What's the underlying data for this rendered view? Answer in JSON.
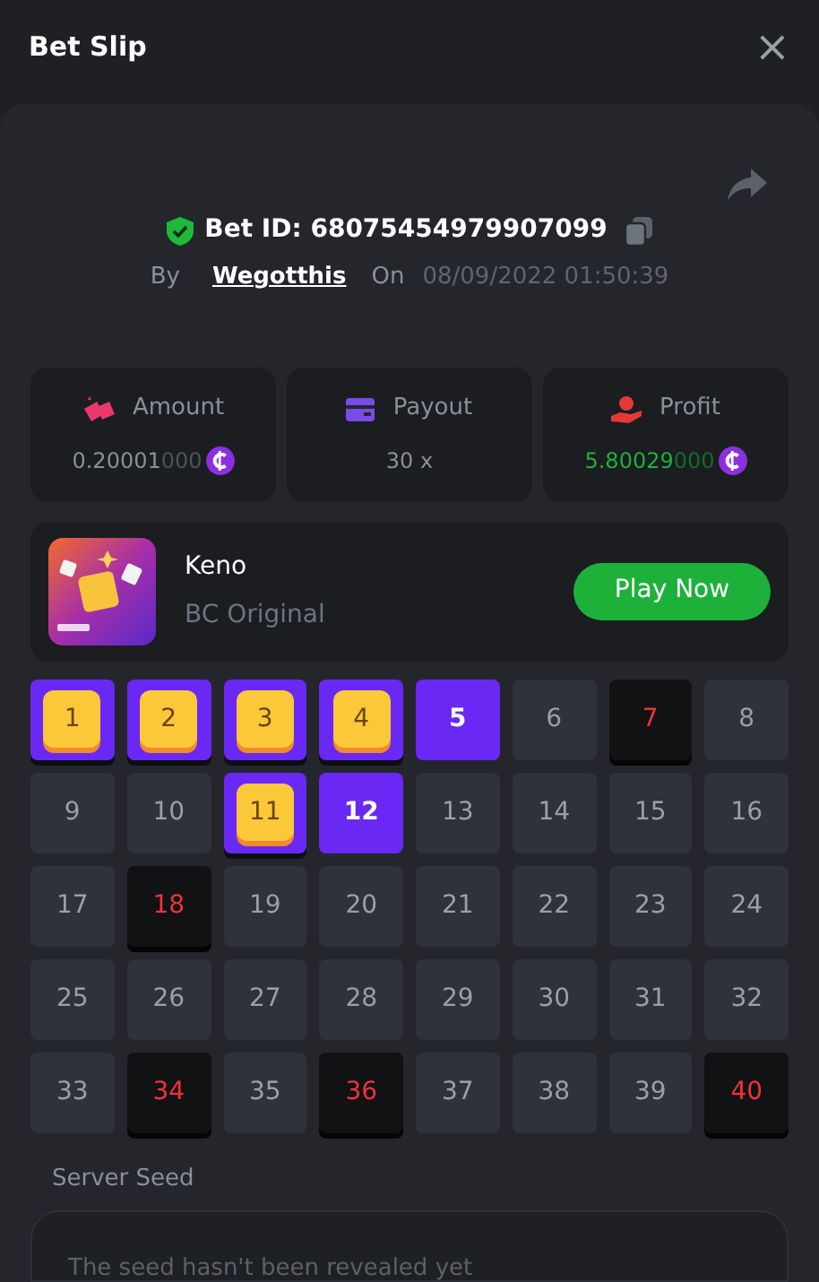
{
  "header": {
    "title": "Bet Slip",
    "close": "×"
  },
  "bet": {
    "id_label": "Bet ID: 68075454979907099",
    "verified": true,
    "by_label": "By",
    "user": "Wegotthis",
    "on_label": "On",
    "date": "08/09/2022 01:50:39"
  },
  "stats": [
    {
      "kind": "amount",
      "label": "Amount",
      "value": "0.20001",
      "trailing": "000",
      "coin": true
    },
    {
      "kind": "payout",
      "label": "Payout",
      "value": "30 x",
      "coin": false
    },
    {
      "kind": "profit",
      "label": "Profit",
      "value": "5.80029",
      "trailing": "000",
      "coin": true
    }
  ],
  "game": {
    "name": "Keno",
    "subtitle": "BC Original",
    "button": "Play Now"
  },
  "tiles": [
    {
      "number": "1",
      "picked": true,
      "drawn": true
    },
    {
      "number": "2",
      "picked": true,
      "drawn": true
    },
    {
      "number": "3",
      "picked": true,
      "drawn": true
    },
    {
      "number": "4",
      "picked": true,
      "drawn": true
    },
    {
      "number": "5",
      "picked": true,
      "drawn": false
    },
    {
      "number": "6",
      "picked": false,
      "drawn": false
    },
    {
      "number": "7",
      "picked": false,
      "drawn": true
    },
    {
      "number": "8",
      "picked": false,
      "drawn": false
    },
    {
      "number": "9",
      "picked": false,
      "drawn": false
    },
    {
      "number": "10",
      "picked": false,
      "drawn": false
    },
    {
      "number": "11",
      "picked": true,
      "drawn": true
    },
    {
      "number": "12",
      "picked": true,
      "drawn": false
    },
    {
      "number": "13",
      "picked": false,
      "drawn": false
    },
    {
      "number": "14",
      "picked": false,
      "drawn": false
    },
    {
      "number": "15",
      "picked": false,
      "drawn": false
    },
    {
      "number": "16",
      "picked": false,
      "drawn": false
    },
    {
      "number": "17",
      "picked": false,
      "drawn": false
    },
    {
      "number": "18",
      "picked": false,
      "drawn": true
    },
    {
      "number": "19",
      "picked": false,
      "drawn": false
    },
    {
      "number": "20",
      "picked": false,
      "drawn": false
    },
    {
      "number": "21",
      "picked": false,
      "drawn": false
    },
    {
      "number": "22",
      "picked": false,
      "drawn": false
    },
    {
      "number": "23",
      "picked": false,
      "drawn": false
    },
    {
      "number": "24",
      "picked": false,
      "drawn": false
    },
    {
      "number": "25",
      "picked": false,
      "drawn": false
    },
    {
      "number": "26",
      "picked": false,
      "drawn": false
    },
    {
      "number": "27",
      "picked": false,
      "drawn": false
    },
    {
      "number": "28",
      "picked": false,
      "drawn": false
    },
    {
      "number": "29",
      "picked": false,
      "drawn": false
    },
    {
      "number": "30",
      "picked": false,
      "drawn": false
    },
    {
      "number": "31",
      "picked": false,
      "drawn": false
    },
    {
      "number": "32",
      "picked": false,
      "drawn": false
    },
    {
      "number": "33",
      "picked": false,
      "drawn": false
    },
    {
      "number": "34",
      "picked": false,
      "drawn": true
    },
    {
      "number": "35",
      "picked": false,
      "drawn": false
    },
    {
      "number": "36",
      "picked": false,
      "drawn": true
    },
    {
      "number": "37",
      "picked": false,
      "drawn": false
    },
    {
      "number": "38",
      "picked": false,
      "drawn": false
    },
    {
      "number": "39",
      "picked": false,
      "drawn": false
    },
    {
      "number": "40",
      "picked": false,
      "drawn": true
    }
  ],
  "server_seed": {
    "label": "Server Seed",
    "value": "The seed hasn't been revealed yet"
  }
}
